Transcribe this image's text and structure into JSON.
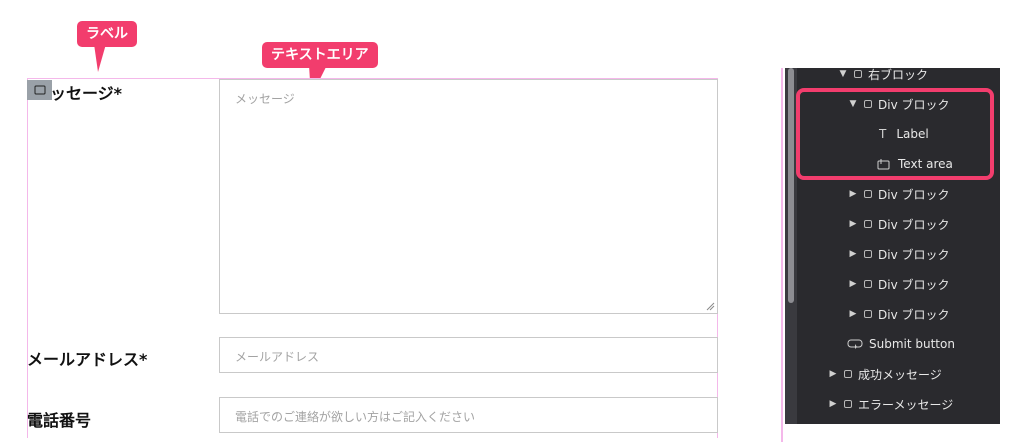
{
  "callouts": {
    "label": "ラベル",
    "textarea": "テキストエリア"
  },
  "form": {
    "message_label": "メッセージ*",
    "message_label_visible": "ッセージ*",
    "message_placeholder": "メッセージ",
    "email_label": "メールアドレス*",
    "email_placeholder": "メールアドレス",
    "phone_label": "電話番号",
    "phone_placeholder": "電話でのご連絡が欲しい方はご記入ください"
  },
  "navigator": {
    "items": [
      {
        "label": "右ブロック",
        "caret": "▼",
        "icon": "square-icon"
      },
      {
        "label": "Div ブロック",
        "caret": "▼",
        "icon": "square-icon"
      },
      {
        "label": "Label",
        "icon": "text-icon",
        "icon_glyph": "T"
      },
      {
        "label": "Text area",
        "icon": "textarea-icon"
      },
      {
        "label": "Div ブロック",
        "caret": "▶",
        "icon": "square-icon"
      },
      {
        "label": "Div ブロック",
        "caret": "▶",
        "icon": "square-icon"
      },
      {
        "label": "Div ブロック",
        "caret": "▶",
        "icon": "square-icon"
      },
      {
        "label": "Div ブロック",
        "caret": "▶",
        "icon": "square-icon"
      },
      {
        "label": "Div ブロック",
        "caret": "▶",
        "icon": "square-icon"
      },
      {
        "label": "Submit button",
        "icon": "submit-button-icon"
      },
      {
        "label": "成功メッセージ",
        "caret": "▶",
        "icon": "square-icon"
      },
      {
        "label": "エラーメッセージ",
        "caret": "▶",
        "icon": "square-icon"
      }
    ]
  },
  "colors": {
    "accent": "#f23d6d",
    "outline": "#f4b8ea",
    "panel_bg": "#2a2a2e"
  }
}
